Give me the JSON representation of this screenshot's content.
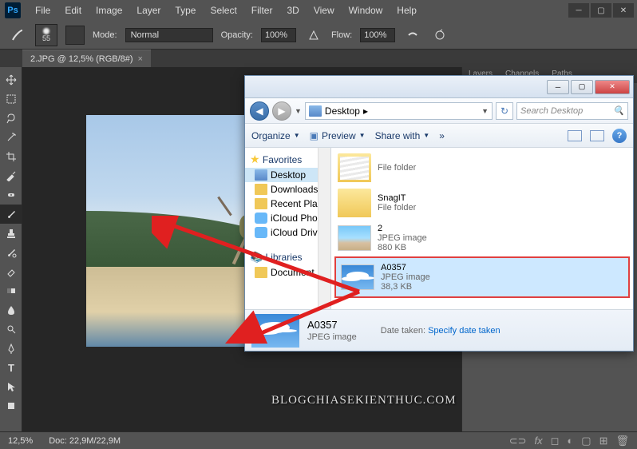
{
  "app": {
    "name": "Ps"
  },
  "menu": [
    "File",
    "Edit",
    "Image",
    "Layer",
    "Type",
    "Select",
    "Filter",
    "3D",
    "View",
    "Window",
    "Help"
  ],
  "options": {
    "brush_size": "55",
    "mode_label": "Mode:",
    "mode_value": "Normal",
    "opacity_label": "Opacity:",
    "opacity_value": "100%",
    "flow_label": "Flow:",
    "flow_value": "100%"
  },
  "tab": {
    "label": "2.JPG @ 12,5% (RGB/8#)",
    "close": "×"
  },
  "status": {
    "zoom": "12,5%",
    "doc": "Doc:  22,9M/22,9M"
  },
  "right_panel": {
    "tabs": [
      "Layers",
      "Channels",
      "Paths"
    ]
  },
  "explorer": {
    "breadcrumb": "Desktop",
    "breadcrumb_arrow": "▸",
    "search_placeholder": "Search Desktop",
    "toolbar": {
      "organize": "Organize",
      "preview": "Preview",
      "share": "Share with",
      "more": "»"
    },
    "tree": {
      "favorites": "Favorites",
      "items_fav": [
        "Desktop",
        "Downloads",
        "Recent Pla",
        "iCloud Pho",
        "iCloud Driv"
      ],
      "libraries": "Libraries",
      "items_lib": [
        "Document"
      ]
    },
    "files": [
      {
        "name": "",
        "type": "File folder",
        "kind": "folder-filled"
      },
      {
        "name": "SnagIT",
        "type": "File folder",
        "kind": "folder"
      },
      {
        "name": "2",
        "type": "JPEG image",
        "size": "880 KB",
        "kind": "img"
      },
      {
        "name": "A0357",
        "type": "JPEG image",
        "size": "38,3 KB",
        "kind": "img-sky",
        "selected": true
      }
    ],
    "details": {
      "name": "A0357",
      "type": "JPEG image",
      "date_label": "Date taken:",
      "date_link": "Specify date taken"
    }
  },
  "watermark": "BLOGCHIASEKIENTHUC.COM"
}
